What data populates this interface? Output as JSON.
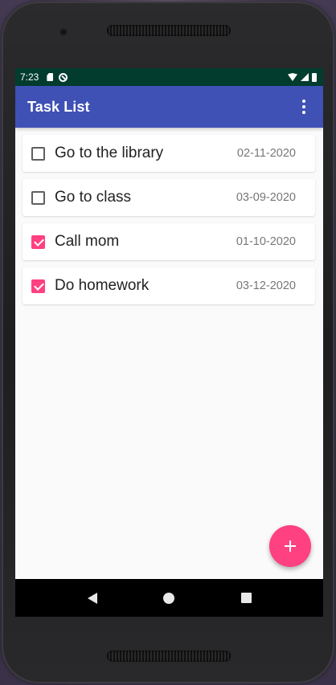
{
  "status_bar": {
    "time": "7:23",
    "icons": [
      "sd-card-icon",
      "sync-icon",
      "wifi-icon",
      "signal-icon",
      "battery-icon"
    ]
  },
  "app_bar": {
    "title": "Task List",
    "overflow_icon": "more-vert-icon",
    "color": "#3f51b5"
  },
  "tasks": [
    {
      "title": "Go to the library",
      "date": "02-11-2020",
      "checked": false
    },
    {
      "title": "Go to class",
      "date": "03-09-2020",
      "checked": false
    },
    {
      "title": "Call mom",
      "date": "01-10-2020",
      "checked": true
    },
    {
      "title": "Do homework",
      "date": "03-12-2020",
      "checked": true
    }
  ],
  "fab": {
    "icon": "add-icon",
    "color": "#ff4081"
  },
  "nav_bar": {
    "icons": [
      "back-icon",
      "home-icon",
      "recents-icon"
    ]
  },
  "colors": {
    "status_bar": "#013c2f",
    "accent": "#ff4081",
    "primary": "#3f51b5"
  }
}
